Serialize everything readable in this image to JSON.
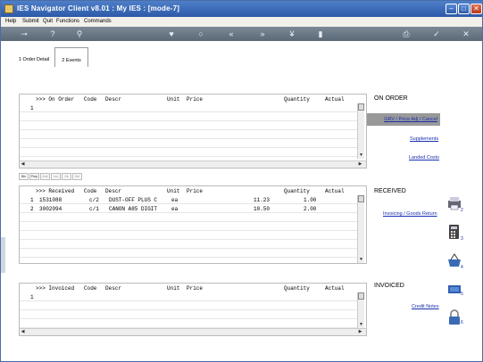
{
  "window": {
    "title": "IES Navigator Client v8.01 : My IES :      [mode-7]",
    "buttons": {
      "minimize": "–",
      "maximize": "□",
      "close": "✕"
    }
  },
  "menu": [
    "Help",
    "Submit",
    "Quit",
    "Functions",
    "Commands"
  ],
  "toolbar": {
    "icons": [
      "key-icon",
      "help-icon",
      "search-icon",
      "heart-icon",
      "refresh-icon",
      "rewind-icon",
      "fast-forward-icon",
      "plug-icon",
      "stop-icon",
      "print-icon",
      "check-icon",
      "close-icon"
    ]
  },
  "tabs": [
    {
      "label": "1 Order Detail"
    },
    {
      "label": "2 Events"
    }
  ],
  "on_order": {
    "columns": [
      ">>> On Order",
      "Code",
      "Descr",
      "Unit",
      "Price",
      "Quantity",
      "Actual"
    ],
    "rows": [
      {
        "no": "1"
      }
    ],
    "mini_buttons": [
      "Bin",
      "Prep",
      "Add",
      "Ins",
      "Ok",
      "Del"
    ]
  },
  "received": {
    "columns": [
      ">>> Received",
      "Code",
      "Descr",
      "Unit",
      "Price",
      "Quantity",
      "Actual"
    ],
    "rows": [
      {
        "no": "1",
        "ref": "1531088",
        "code": "c/2",
        "descr": "DUST-OFF PLUS C",
        "unit": "ea",
        "price": "11.23",
        "qty": "1.00"
      },
      {
        "no": "2",
        "ref": "3002094",
        "code": "c/1",
        "descr": "CANON A85 DIGIT",
        "unit": "ea",
        "price": "10.50",
        "qty": "2.00"
      }
    ]
  },
  "invoiced": {
    "columns": [
      ">>> Invoiced",
      "Code",
      "Descr",
      "Unit",
      "Price",
      "Quantity",
      "Actual"
    ],
    "rows": [
      {
        "no": "1"
      }
    ]
  },
  "side": {
    "on_order_title": "ON ORDER",
    "grv_link": "GRV / Price Adj / Cancel",
    "supplements_link": "Supplements",
    "landed_costs_link": "Landed Costs",
    "received_title": "RECEIVED",
    "invoicing_link": "Invoicing / Goods Return",
    "invoiced_title": "INVOICED",
    "credit_notes_link": "Credit Notes",
    "icon_numbers": [
      "2",
      "3",
      "4",
      "5",
      "6"
    ]
  }
}
